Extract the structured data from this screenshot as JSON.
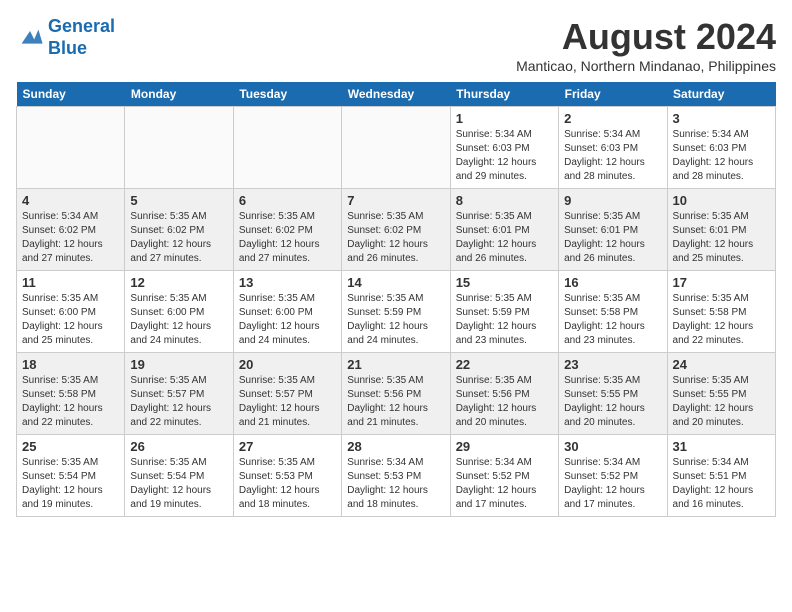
{
  "logo": {
    "line1": "General",
    "line2": "Blue"
  },
  "title": "August 2024",
  "location": "Manticao, Northern Mindanao, Philippines",
  "headers": [
    "Sunday",
    "Monday",
    "Tuesday",
    "Wednesday",
    "Thursday",
    "Friday",
    "Saturday"
  ],
  "weeks": [
    [
      {
        "day": "",
        "info": ""
      },
      {
        "day": "",
        "info": ""
      },
      {
        "day": "",
        "info": ""
      },
      {
        "day": "",
        "info": ""
      },
      {
        "day": "1",
        "info": "Sunrise: 5:34 AM\nSunset: 6:03 PM\nDaylight: 12 hours\nand 29 minutes."
      },
      {
        "day": "2",
        "info": "Sunrise: 5:34 AM\nSunset: 6:03 PM\nDaylight: 12 hours\nand 28 minutes."
      },
      {
        "day": "3",
        "info": "Sunrise: 5:34 AM\nSunset: 6:03 PM\nDaylight: 12 hours\nand 28 minutes."
      }
    ],
    [
      {
        "day": "4",
        "info": "Sunrise: 5:34 AM\nSunset: 6:02 PM\nDaylight: 12 hours\nand 27 minutes."
      },
      {
        "day": "5",
        "info": "Sunrise: 5:35 AM\nSunset: 6:02 PM\nDaylight: 12 hours\nand 27 minutes."
      },
      {
        "day": "6",
        "info": "Sunrise: 5:35 AM\nSunset: 6:02 PM\nDaylight: 12 hours\nand 27 minutes."
      },
      {
        "day": "7",
        "info": "Sunrise: 5:35 AM\nSunset: 6:02 PM\nDaylight: 12 hours\nand 26 minutes."
      },
      {
        "day": "8",
        "info": "Sunrise: 5:35 AM\nSunset: 6:01 PM\nDaylight: 12 hours\nand 26 minutes."
      },
      {
        "day": "9",
        "info": "Sunrise: 5:35 AM\nSunset: 6:01 PM\nDaylight: 12 hours\nand 26 minutes."
      },
      {
        "day": "10",
        "info": "Sunrise: 5:35 AM\nSunset: 6:01 PM\nDaylight: 12 hours\nand 25 minutes."
      }
    ],
    [
      {
        "day": "11",
        "info": "Sunrise: 5:35 AM\nSunset: 6:00 PM\nDaylight: 12 hours\nand 25 minutes."
      },
      {
        "day": "12",
        "info": "Sunrise: 5:35 AM\nSunset: 6:00 PM\nDaylight: 12 hours\nand 24 minutes."
      },
      {
        "day": "13",
        "info": "Sunrise: 5:35 AM\nSunset: 6:00 PM\nDaylight: 12 hours\nand 24 minutes."
      },
      {
        "day": "14",
        "info": "Sunrise: 5:35 AM\nSunset: 5:59 PM\nDaylight: 12 hours\nand 24 minutes."
      },
      {
        "day": "15",
        "info": "Sunrise: 5:35 AM\nSunset: 5:59 PM\nDaylight: 12 hours\nand 23 minutes."
      },
      {
        "day": "16",
        "info": "Sunrise: 5:35 AM\nSunset: 5:58 PM\nDaylight: 12 hours\nand 23 minutes."
      },
      {
        "day": "17",
        "info": "Sunrise: 5:35 AM\nSunset: 5:58 PM\nDaylight: 12 hours\nand 22 minutes."
      }
    ],
    [
      {
        "day": "18",
        "info": "Sunrise: 5:35 AM\nSunset: 5:58 PM\nDaylight: 12 hours\nand 22 minutes."
      },
      {
        "day": "19",
        "info": "Sunrise: 5:35 AM\nSunset: 5:57 PM\nDaylight: 12 hours\nand 22 minutes."
      },
      {
        "day": "20",
        "info": "Sunrise: 5:35 AM\nSunset: 5:57 PM\nDaylight: 12 hours\nand 21 minutes."
      },
      {
        "day": "21",
        "info": "Sunrise: 5:35 AM\nSunset: 5:56 PM\nDaylight: 12 hours\nand 21 minutes."
      },
      {
        "day": "22",
        "info": "Sunrise: 5:35 AM\nSunset: 5:56 PM\nDaylight: 12 hours\nand 20 minutes."
      },
      {
        "day": "23",
        "info": "Sunrise: 5:35 AM\nSunset: 5:55 PM\nDaylight: 12 hours\nand 20 minutes."
      },
      {
        "day": "24",
        "info": "Sunrise: 5:35 AM\nSunset: 5:55 PM\nDaylight: 12 hours\nand 20 minutes."
      }
    ],
    [
      {
        "day": "25",
        "info": "Sunrise: 5:35 AM\nSunset: 5:54 PM\nDaylight: 12 hours\nand 19 minutes."
      },
      {
        "day": "26",
        "info": "Sunrise: 5:35 AM\nSunset: 5:54 PM\nDaylight: 12 hours\nand 19 minutes."
      },
      {
        "day": "27",
        "info": "Sunrise: 5:35 AM\nSunset: 5:53 PM\nDaylight: 12 hours\nand 18 minutes."
      },
      {
        "day": "28",
        "info": "Sunrise: 5:34 AM\nSunset: 5:53 PM\nDaylight: 12 hours\nand 18 minutes."
      },
      {
        "day": "29",
        "info": "Sunrise: 5:34 AM\nSunset: 5:52 PM\nDaylight: 12 hours\nand 17 minutes."
      },
      {
        "day": "30",
        "info": "Sunrise: 5:34 AM\nSunset: 5:52 PM\nDaylight: 12 hours\nand 17 minutes."
      },
      {
        "day": "31",
        "info": "Sunrise: 5:34 AM\nSunset: 5:51 PM\nDaylight: 12 hours\nand 16 minutes."
      }
    ]
  ]
}
